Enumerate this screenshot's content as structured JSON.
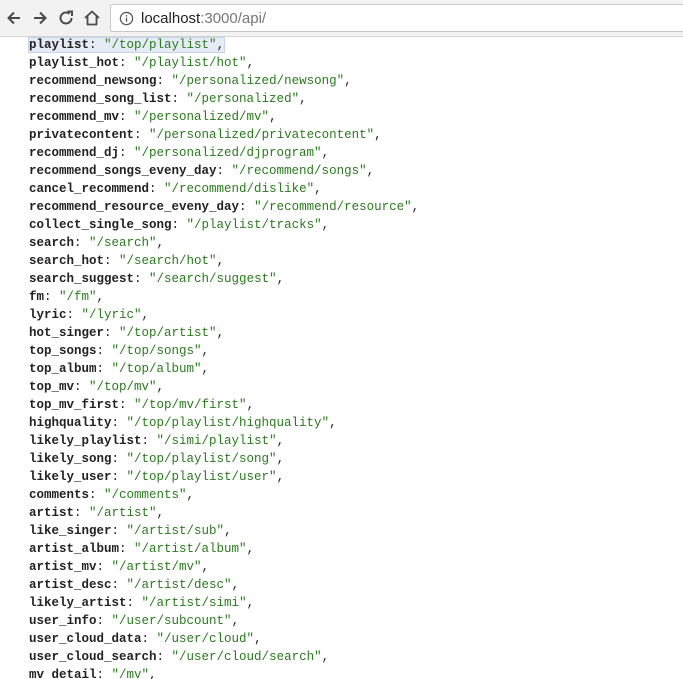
{
  "browser": {
    "url_host": "localhost",
    "url_rest": ":3000/api/",
    "back_icon": "arrow-left-icon",
    "forward_icon": "arrow-right-icon",
    "reload_icon": "reload-icon",
    "home_icon": "home-icon",
    "info_icon": "info-circle-icon"
  },
  "entries": [
    {
      "key": "playlist",
      "value": "\"/top/playlist\""
    },
    {
      "key": "playlist_hot",
      "value": "\"/playlist/hot\""
    },
    {
      "key": "recommend_newsong",
      "value": "\"/personalized/newsong\""
    },
    {
      "key": "recommend_song_list",
      "value": "\"/personalized\""
    },
    {
      "key": "recommend_mv",
      "value": "\"/personalized/mv\""
    },
    {
      "key": "privatecontent",
      "value": "\"/personalized/privatecontent\""
    },
    {
      "key": "recommend_dj",
      "value": "\"/personalized/djprogram\""
    },
    {
      "key": "recommend_songs_eveny_day",
      "value": "\"/recommend/songs\""
    },
    {
      "key": "cancel_recommend",
      "value": "\"/recommend/dislike\""
    },
    {
      "key": "recommend_resource_eveny_day",
      "value": "\"/recommend/resource\""
    },
    {
      "key": "collect_single_song",
      "value": "\"/playlist/tracks\""
    },
    {
      "key": "search",
      "value": "\"/search\""
    },
    {
      "key": "search_hot",
      "value": "\"/search/hot\""
    },
    {
      "key": "search_suggest",
      "value": "\"/search/suggest\""
    },
    {
      "key": "fm",
      "value": "\"/fm\""
    },
    {
      "key": "lyric",
      "value": "\"/lyric\""
    },
    {
      "key": "hot_singer",
      "value": "\"/top/artist\""
    },
    {
      "key": "top_songs",
      "value": "\"/top/songs\""
    },
    {
      "key": "top_album",
      "value": "\"/top/album\""
    },
    {
      "key": "top_mv",
      "value": "\"/top/mv\""
    },
    {
      "key": "top_mv_first",
      "value": "\"/top/mv/first\""
    },
    {
      "key": "highquality",
      "value": "\"/top/playlist/highquality\""
    },
    {
      "key": "likely_playlist",
      "value": "\"/simi/playlist\""
    },
    {
      "key": "likely_song",
      "value": "\"/top/playlist/song\""
    },
    {
      "key": "likely_user",
      "value": "\"/top/playlist/user\""
    },
    {
      "key": "comments",
      "value": "\"/comments\""
    },
    {
      "key": "artist",
      "value": "\"/artist\""
    },
    {
      "key": "like_singer",
      "value": "\"/artist/sub\""
    },
    {
      "key": "artist_album",
      "value": "\"/artist/album\""
    },
    {
      "key": "artist_mv",
      "value": "\"/artist/mv\""
    },
    {
      "key": "artist_desc",
      "value": "\"/artist/desc\""
    },
    {
      "key": "likely_artist",
      "value": "\"/artist/simi\""
    },
    {
      "key": "user_info",
      "value": "\"/user/subcount\""
    },
    {
      "key": "user_cloud_data",
      "value": "\"/user/cloud\""
    },
    {
      "key": "user_cloud_search",
      "value": "\"/user/cloud/search\""
    },
    {
      "key": "mv_detail",
      "value": "\"/mv\""
    }
  ],
  "punctuation": {
    "colon": ": ",
    "comma": ","
  }
}
